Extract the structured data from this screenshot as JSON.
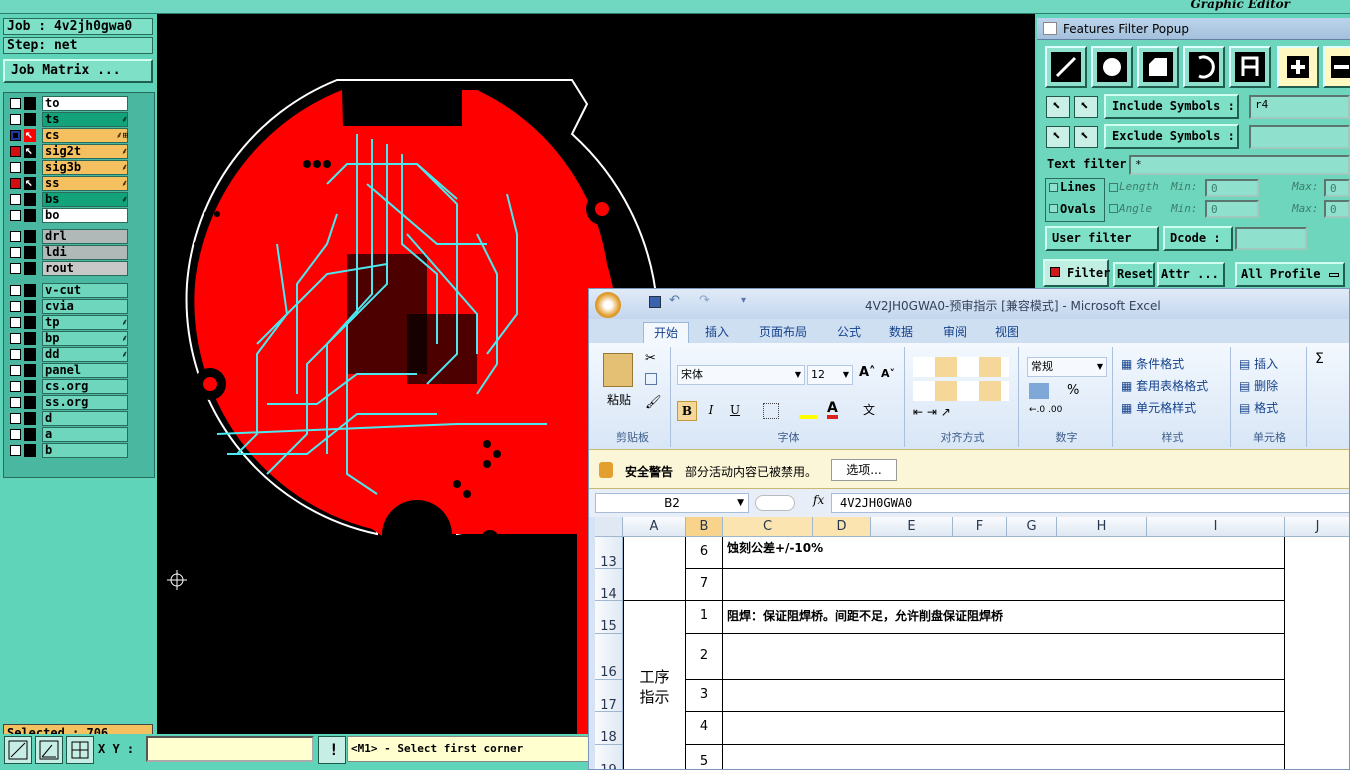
{
  "app": {
    "title": "Graphic Editor"
  },
  "left_panel": {
    "job": "Job : 4v2jh0gwa0",
    "step": "Step: net",
    "job_matrix_button": "Job Matrix ...",
    "layers_group1": [
      {
        "name": "to",
        "color": "#ffffff",
        "checked": false
      },
      {
        "name": "ts",
        "color": "#12a37a",
        "checked": false
      },
      {
        "name": "cs",
        "color": "#f5c060",
        "checked": true,
        "active": true
      },
      {
        "name": "sig2t",
        "color": "#f5c060",
        "checked": true
      },
      {
        "name": "sig3b",
        "color": "#f5c060",
        "checked": false
      },
      {
        "name": "ss",
        "color": "#f5c060",
        "checked": true
      },
      {
        "name": "bs",
        "color": "#12a37a",
        "checked": false
      },
      {
        "name": "bo",
        "color": "#ffffff",
        "checked": false
      }
    ],
    "layers_group2": [
      {
        "name": "drl",
        "color": "#b0b8b8"
      },
      {
        "name": "ldi",
        "color": "#b0b8b8"
      },
      {
        "name": "rout",
        "color": "#c8c8c8"
      }
    ],
    "layers_group3": [
      {
        "name": "v-cut"
      },
      {
        "name": "cvia"
      },
      {
        "name": "tp"
      },
      {
        "name": "bp"
      },
      {
        "name": "dd"
      },
      {
        "name": "panel"
      },
      {
        "name": "cs.org"
      },
      {
        "name": "ss.org"
      },
      {
        "name": "d"
      },
      {
        "name": "a"
      },
      {
        "name": "b"
      }
    ],
    "selected": "Selected : 706"
  },
  "bottom_bar": {
    "xy_label": "X Y :",
    "xy_value": "",
    "status_text": "<M1> - Select first corner"
  },
  "features_filter": {
    "title": "Features Filter Popup",
    "include_symbols_label": "Include Symbols :",
    "include_symbols_value": "r4",
    "exclude_symbols_label": "Exclude Symbols :",
    "exclude_symbols_value": "",
    "text_filter_label": "Text filter",
    "text_filter_value": "*",
    "lines_label": "Lines",
    "ovals_label": "Ovals",
    "length_label": "Length",
    "angle_label": "Angle",
    "min_label": "Min:",
    "max_label": "Max:",
    "length_min": "0",
    "length_max": "0",
    "angle_min": "0",
    "angle_max": "0",
    "user_filter_button": "User filter ...",
    "dcode_button": "Dcode :",
    "dcode_value": "",
    "filter_button": "Filter",
    "reset_button": "Reset",
    "attr_button": "Attr ...",
    "profile_select": "All Profile"
  },
  "excel": {
    "title": "4V2JH0GWA0-预审指示  [兼容模式] - Microsoft Excel",
    "tabs": [
      "开始",
      "插入",
      "页面布局",
      "公式",
      "数据",
      "审阅",
      "视图"
    ],
    "clipboard": {
      "paste": "粘贴",
      "group": "剪贴板"
    },
    "font": {
      "name": "宋体",
      "size": "12",
      "group": "字体"
    },
    "alignment_group": "对齐方式",
    "number": {
      "format": "常规",
      "group": "数字",
      "percent": "%"
    },
    "styles": {
      "conditional": "条件格式",
      "table": "套用表格格式",
      "cell": "单元格样式",
      "group": "样式"
    },
    "cells": {
      "insert": "插入",
      "delete": "删除",
      "format": "格式",
      "group": "单元格"
    },
    "security_warning": {
      "title": "安全警告",
      "message": "部分活动内容已被禁用。",
      "options_button": "选项..."
    },
    "name_box": "B2",
    "formula_value": "4V2JH0GWA0",
    "columns": [
      "A",
      "B",
      "C",
      "D",
      "E",
      "F",
      "G",
      "H",
      "I",
      "J"
    ],
    "rows": [
      {
        "row": "13",
        "b": "6",
        "c": "蚀刻公差+/-10%"
      },
      {
        "row": "14",
        "b": "7",
        "c": ""
      },
      {
        "row": "15",
        "b": "1",
        "c": "阻焊：保证阻焊桥。间距不足，允许削盘保证阻焊桥"
      },
      {
        "row": "16",
        "b": "2",
        "c": ""
      },
      {
        "row": "17",
        "b": "3",
        "c": ""
      },
      {
        "row": "18",
        "b": "4",
        "c": ""
      },
      {
        "row": "19",
        "b": "5",
        "c": ""
      }
    ],
    "merged_a_label_line1": "工序",
    "merged_a_label_line2": "指示"
  },
  "colors": {
    "board_red": "#ff0000",
    "trace_cyan": "#4ce8f0",
    "panel_teal": "#5fd4b8"
  }
}
